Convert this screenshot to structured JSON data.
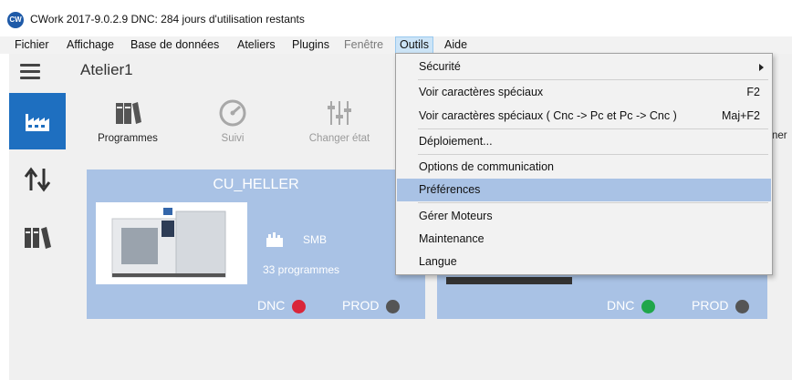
{
  "window": {
    "logo_text": "CW",
    "title": "CWork 2017-9.0.2.9  DNC: 284 jours d'utilisation restants"
  },
  "menubar": [
    {
      "label": "Fichier",
      "state": "normal"
    },
    {
      "label": "Affichage",
      "state": "normal"
    },
    {
      "label": "Base de données",
      "state": "normal"
    },
    {
      "label": "Ateliers",
      "state": "normal"
    },
    {
      "label": "Plugins",
      "state": "normal"
    },
    {
      "label": "Fenêtre",
      "state": "disabled"
    },
    {
      "label": "Outils",
      "state": "active"
    },
    {
      "label": "Aide",
      "state": "normal"
    }
  ],
  "workspace": {
    "title": "Atelier1"
  },
  "sidebar": {
    "items": [
      {
        "icon": "factory-icon",
        "selected": true
      },
      {
        "icon": "transfer-arrows-icon",
        "selected": false
      },
      {
        "icon": "binders-icon",
        "selected": false
      }
    ]
  },
  "toolbar": {
    "programmes": "Programmes",
    "suivi": "Suivi",
    "changer_etat": "Changer état",
    "clipped_label": "ner"
  },
  "cards": [
    {
      "title": "CU_HELLER",
      "controller": "SMB",
      "programs": "33 programmes",
      "dnc_label": "DNC",
      "dnc_color": "#d9263a",
      "prod_label": "PROD",
      "prod_color": "#555555"
    },
    {
      "title": "",
      "dnc_label": "DNC",
      "dnc_color": "#1fa64a",
      "prod_label": "PROD",
      "prod_color": "#555555"
    }
  ],
  "outils_menu": {
    "items": [
      {
        "label": "Sécurité",
        "shortcut": "",
        "submenu": true
      },
      {
        "label": "Voir caractères spéciaux",
        "shortcut": "F2"
      },
      {
        "label": "Voir caractères spéciaux ( Cnc -> Pc et Pc -> Cnc )",
        "shortcut": "Maj+F2"
      },
      {
        "label": "Déploiement...",
        "shortcut": ""
      },
      {
        "label": "Options de communication",
        "shortcut": ""
      },
      {
        "label": "Préférences",
        "shortcut": "",
        "highlighted": true
      },
      {
        "label": "Gérer Moteurs",
        "shortcut": ""
      },
      {
        "label": "Maintenance",
        "shortcut": ""
      },
      {
        "label": "Langue",
        "shortcut": ""
      }
    ]
  },
  "colors": {
    "accent": "#1e6fc0",
    "card_bg": "#a9c2e5",
    "menu_highlight": "#a9c2e5"
  }
}
